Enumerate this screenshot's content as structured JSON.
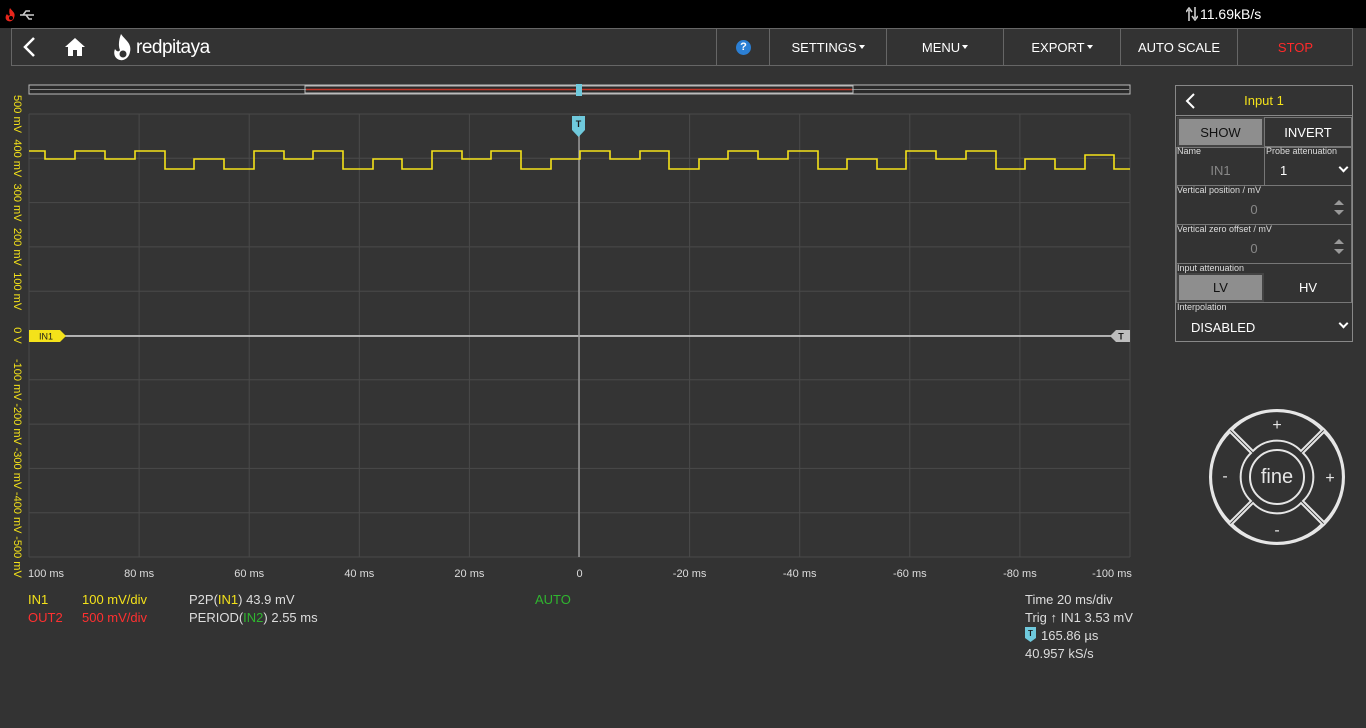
{
  "topbar": {
    "transfer_rate": "11.69kB/s"
  },
  "navbar": {
    "brand": "redpitaya",
    "help_label": "?",
    "settings_label": "SETTINGS",
    "menu_label": "MENU",
    "export_label": "EXPORT",
    "autoscale_label": "AUTO SCALE",
    "stop_label": "STOP"
  },
  "scope": {
    "y_ticks": [
      "500 mV",
      "400 mV",
      "300 mV",
      "200 mV",
      "100 mV",
      "0 V",
      "-100 mV",
      "-200 mV",
      "-300 mV",
      "-400 mV",
      "-500 mV"
    ],
    "x_ticks": [
      "100 ms",
      "80 ms",
      "60 ms",
      "40 ms",
      "20 ms",
      "0",
      "-20 ms",
      "-40 ms",
      "-60 ms",
      "-80 ms",
      "-100 ms"
    ],
    "channel_marker": "IN1",
    "trigger_marker": "T",
    "trigger_level_marker": "T"
  },
  "measurements": {
    "in1_label": "IN1",
    "in1_scale": "100 mV/div",
    "out2_label": "OUT2",
    "out2_scale": "500 mV/div",
    "p2p_prefix": "P2P(",
    "p2p_channel": "IN1",
    "p2p_value": ") 43.9 mV",
    "period_prefix": "PERIOD(",
    "period_channel": "IN2",
    "period_value": ") 2.55 ms",
    "mode": "AUTO",
    "time": "Time 20 ms/div",
    "trig": "Trig ↑ IN1 3.53 mV",
    "trig_delay": "165.86 µs",
    "sample_rate": "40.957 kS/s",
    "trig_delay_icon_label": "T"
  },
  "panel": {
    "title": "Input 1",
    "show_label": "SHOW",
    "invert_label": "INVERT",
    "name_label": "Name",
    "name_value": "IN1",
    "probe_label": "Probe attenuation",
    "probe_value": "1",
    "vpos_label": "Vertical position / mV",
    "vpos_value": "0",
    "vzero_label": "Vertical zero offset / mV",
    "vzero_value": "0",
    "input_att_label": "Input attenuation",
    "lv_label": "LV",
    "hv_label": "HV",
    "interp_label": "Interpolation",
    "interp_value": "DISABLED"
  },
  "dial": {
    "center_label": "fine",
    "plus": "+",
    "minus": "-"
  },
  "colors": {
    "ch1": "#f4e21a",
    "out2": "#ff3030",
    "trigger": "#6fc9dc",
    "auto": "#2fb52f"
  }
}
